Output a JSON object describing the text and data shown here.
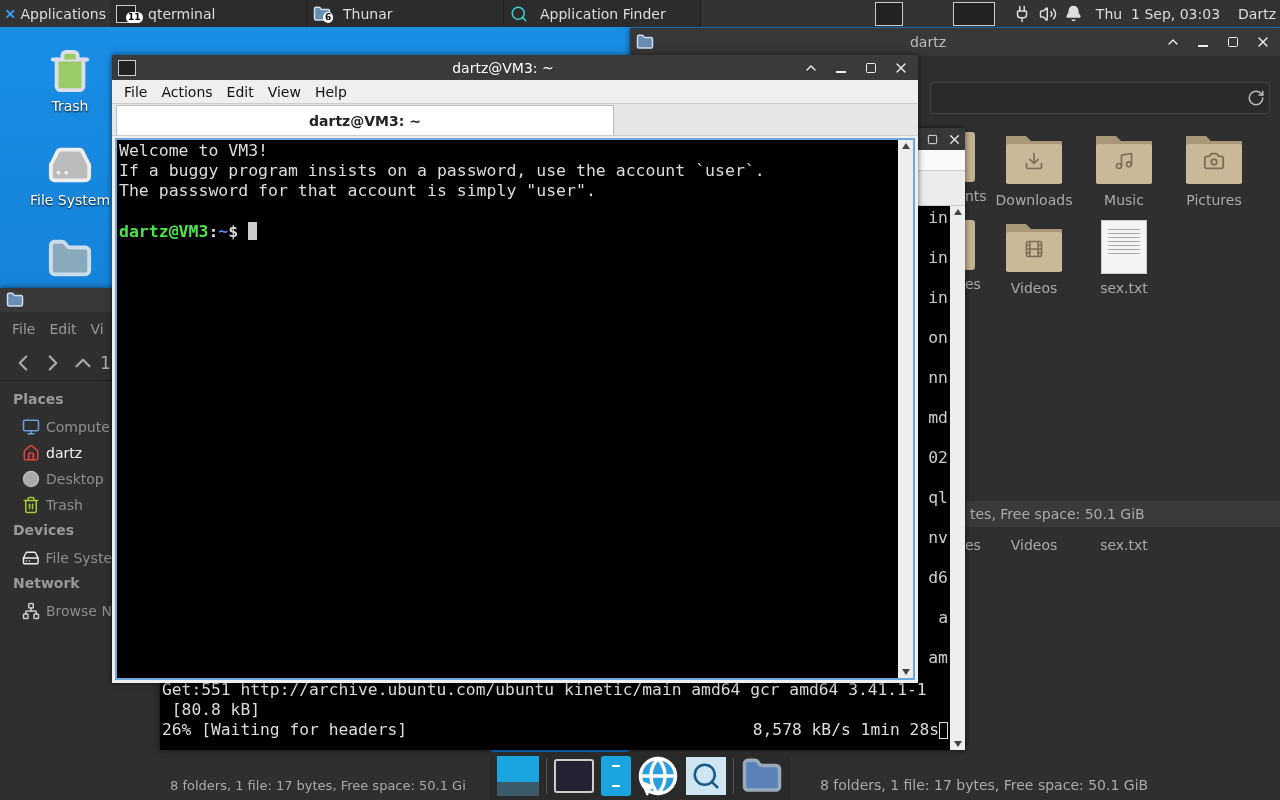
{
  "panel": {
    "menu": "Applications",
    "tasks": [
      {
        "label": "qterminal",
        "badge": "11",
        "kind": "terminal"
      },
      {
        "label": "Thunar",
        "badge": "6",
        "kind": "files"
      },
      {
        "label": "Application Finder",
        "kind": "finder"
      }
    ],
    "clock": "Thu  1 Sep, 03:03",
    "user": "Dartz"
  },
  "desktop_icons": [
    {
      "label": "Trash",
      "kind": "trash"
    },
    {
      "label": "File System",
      "kind": "drive"
    },
    {
      "kind": "folder"
    }
  ],
  "file_manager_right": {
    "title": "dartz",
    "items": [
      {
        "label": "nts",
        "kind": "partial"
      },
      {
        "label": "Downloads",
        "kind": "downloads"
      },
      {
        "label": "Music",
        "kind": "music"
      },
      {
        "label": "Pictures",
        "kind": "pictures"
      },
      {
        "label": "es",
        "kind": "partial"
      },
      {
        "label": "Videos",
        "kind": "videos"
      },
      {
        "label": "sex.txt",
        "kind": "text"
      }
    ],
    "status": "tes, Free space: 50.1 GiB",
    "lower_labels": [
      "es",
      "Videos",
      "sex.txt"
    ],
    "bottom_status": "8 folders, 1 file: 17 bytes, Free space: 50.1 GiB"
  },
  "file_manager_left": {
    "menu": [
      "File",
      "Edit",
      "Vi"
    ],
    "path_fragment": "1",
    "sections": [
      {
        "title": "Places",
        "items": [
          {
            "label": "Compute",
            "kind": "computer",
            "selected": false
          },
          {
            "label": "dartz",
            "kind": "home",
            "selected": true
          },
          {
            "label": "Desktop",
            "kind": "desktop",
            "selected": false
          },
          {
            "label": "Trash",
            "kind": "trash",
            "selected": false
          }
        ]
      },
      {
        "title": "Devices",
        "items": [
          {
            "label": "File Syste",
            "kind": "drive",
            "selected": false
          }
        ]
      },
      {
        "title": "Network",
        "items": [
          {
            "label": "Browse N",
            "kind": "network",
            "selected": false
          }
        ]
      }
    ],
    "status": "8 folders, 1 file: 17 bytes, Free space: 50.1 Gi"
  },
  "terminal_back": {
    "fragments": [
      "in",
      "in",
      "in",
      "on",
      "nn",
      "md",
      "02",
      "ql",
      "nv",
      "d6",
      "a",
      "am"
    ],
    "lines": [
      "Get:551 http://archive.ubuntu.com/ubuntu kinetic/main amd64 gcr amd64 3.41.1-1",
      " [80.8 kB]"
    ],
    "progress": "26% [Waiting for headers]",
    "rate": "8,578 kB/s 1min 28s"
  },
  "terminal": {
    "title": "dartz@VM3: ~",
    "menu": [
      "File",
      "Actions",
      "Edit",
      "View",
      "Help"
    ],
    "tabs": [
      {
        "label": "dartz@VM3: ~",
        "selected": true
      }
    ],
    "lines": [
      "Welcome to VM3!",
      "If a buggy program insists on a password, use the account `user`.",
      "The passsword for that account is simply \"user\"."
    ],
    "prompt": {
      "user": "dartz@VM3",
      "separator": ":",
      "path": "~",
      "symbol": "$"
    }
  }
}
